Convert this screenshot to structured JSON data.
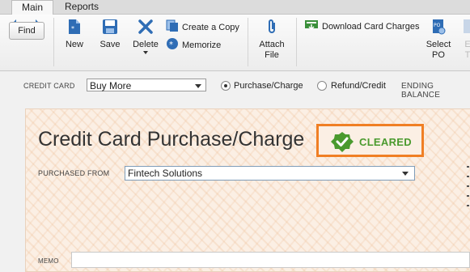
{
  "tabs": [
    {
      "label": "Main",
      "active": true
    },
    {
      "label": "Reports",
      "active": false
    }
  ],
  "toolbar": {
    "find": "Find",
    "new": "New",
    "save": "Save",
    "delete": "Delete",
    "create_copy": "Create a Copy",
    "memorize": "Memorize",
    "attach_file_line1": "Attach",
    "attach_file_line2": "File",
    "download_card_charges": "Download Card Charges",
    "select_po_line1": "Select",
    "select_po_line2": "PO",
    "partial_line1": "E",
    "partial_line2": "T"
  },
  "form_bar": {
    "credit_card_label": "CREDIT CARD",
    "credit_card_value": "Buy More",
    "purchase_charge_label": "Purchase/Charge",
    "refund_credit_label": "Refund/Credit",
    "selected_type": "Purchase/Charge",
    "ending_balance_label": "ENDING BALANCE"
  },
  "check": {
    "title": "Credit Card Purchase/Charge",
    "status": "CLEARED",
    "purchased_from_label": "PURCHASED FROM",
    "purchased_from_value": "Fintech Solutions",
    "memo_label": "MEMO"
  },
  "colors": {
    "highlight_border": "#f07f24",
    "cleared_green": "#4a9a2e",
    "check_background": "#fbefe4"
  }
}
